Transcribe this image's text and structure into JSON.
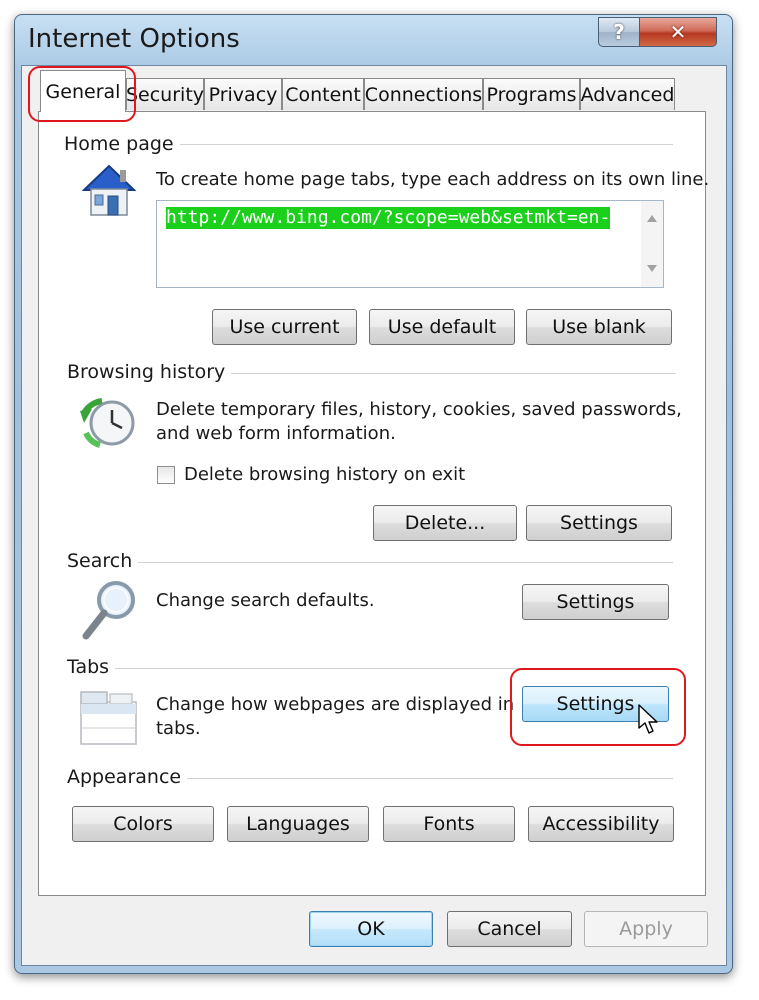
{
  "window": {
    "title": "Internet Options",
    "help_glyph": "?",
    "close_glyph": "✕"
  },
  "tabs": [
    {
      "label": "General",
      "active": true
    },
    {
      "label": "Security"
    },
    {
      "label": "Privacy"
    },
    {
      "label": "Content"
    },
    {
      "label": "Connections"
    },
    {
      "label": "Programs"
    },
    {
      "label": "Advanced"
    }
  ],
  "home_page": {
    "group_label": "Home page",
    "description": "To create home page tabs, type each address on its own line.",
    "url_value": "http://www.bing.com/?scope=web&setmkt=en-",
    "use_current": "Use current",
    "use_default": "Use default",
    "use_blank": "Use blank"
  },
  "browsing_history": {
    "group_label": "Browsing history",
    "description_line1": "Delete temporary files, history, cookies, saved passwords,",
    "description_line2": "and web form information.",
    "checkbox_label": "Delete browsing history on exit",
    "delete_button": "Delete...",
    "settings_button": "Settings"
  },
  "search": {
    "group_label": "Search",
    "description": "Change search defaults.",
    "settings_button": "Settings"
  },
  "tabs_group": {
    "group_label": "Tabs",
    "description_line1": "Change how webpages are displayed in",
    "description_line2": "tabs.",
    "settings_button": "Settings"
  },
  "appearance": {
    "group_label": "Appearance",
    "colors": "Colors",
    "languages": "Languages",
    "fonts": "Fonts",
    "accessibility": "Accessibility"
  },
  "footer": {
    "ok": "OK",
    "cancel": "Cancel",
    "apply": "Apply"
  },
  "colors": {
    "highlight": "#e0181e",
    "url_selection": "#1bd01b"
  },
  "icons": [
    "help-icon",
    "close-icon",
    "home-icon",
    "history-clock-icon",
    "magnifier-icon",
    "tabs-icon",
    "mouse-cursor-icon"
  ]
}
